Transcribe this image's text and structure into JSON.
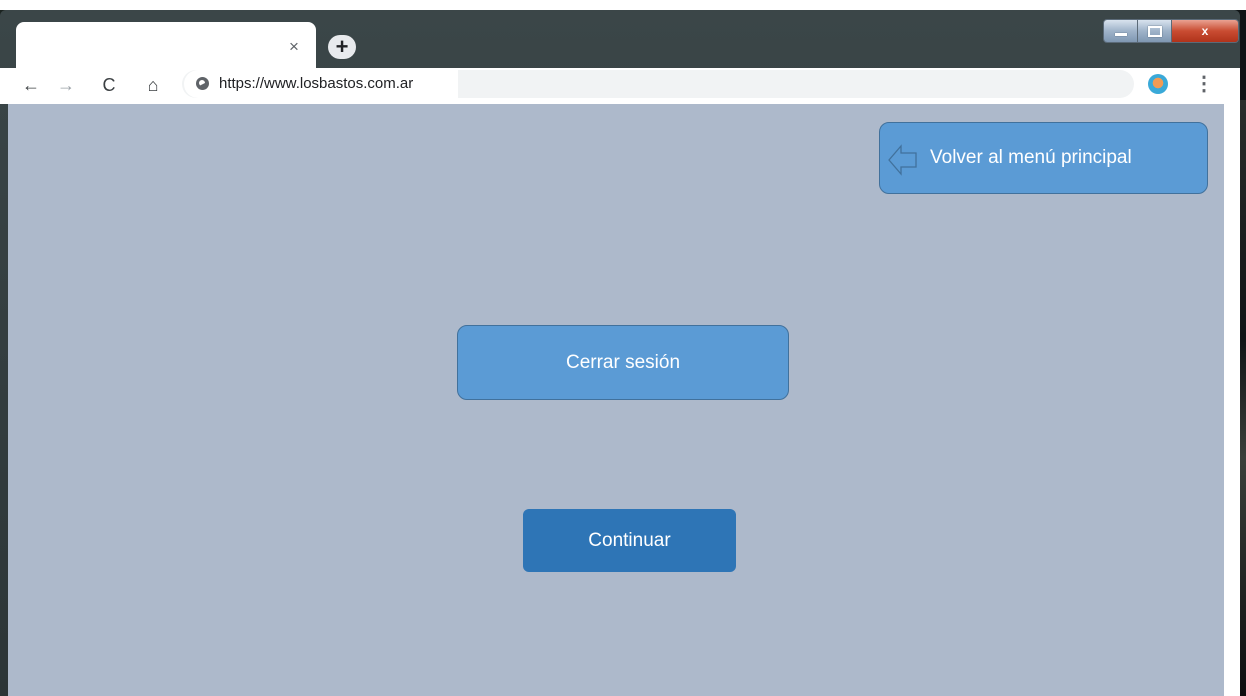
{
  "browser": {
    "tab_close_glyph": "×",
    "new_tab_glyph": "+",
    "window_controls": {
      "minimize_icon": "minimize-icon",
      "maximize_icon": "maximize-icon",
      "close_glyph": "x"
    },
    "toolbar": {
      "back_glyph": "←",
      "forward_glyph": "→",
      "reload_glyph": "C",
      "home_glyph": "⌂",
      "url": "https://www.losbastos.com.ar",
      "menu_glyph": "⋮"
    }
  },
  "page": {
    "background_color": "#adb9cb",
    "back_button": {
      "label": "Volver al menú principal",
      "icon": "arrow-left-outline-icon"
    },
    "logout_button": {
      "label": "Cerrar sesión"
    },
    "continue_button": {
      "label": "Continuar"
    }
  },
  "colors": {
    "button_light": "#5b9bd5",
    "button_dark": "#2e75b6",
    "button_border": "#41719c"
  }
}
